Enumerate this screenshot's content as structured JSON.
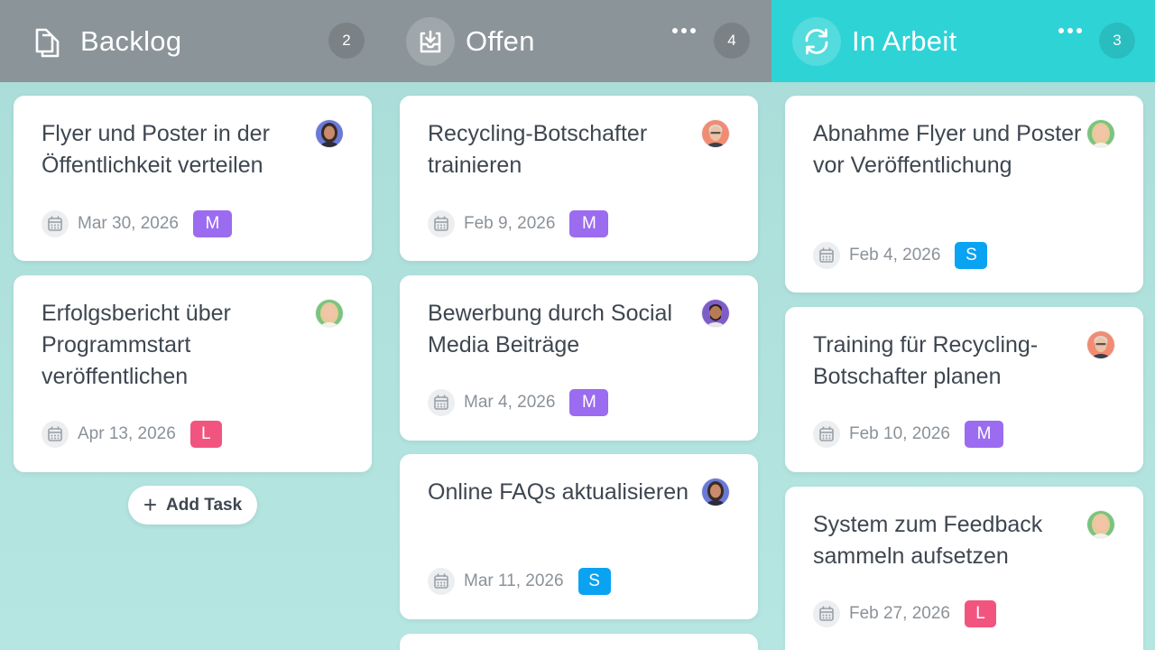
{
  "columns": [
    {
      "title": "Backlog",
      "count": "2",
      "cards": [
        {
          "title": "Flyer und Poster in der Öffentlichkeit verteilen",
          "date": "Mar 30, 2026",
          "size": "M",
          "avatar": "avatar-woman-dark-hair"
        },
        {
          "title": "Erfolgsbericht über Programmstart veröffentlichen",
          "date": "Apr 13, 2026",
          "size": "L",
          "avatar": "avatar-woman-blonde"
        }
      ],
      "add_task_label": "Add Task"
    },
    {
      "title": "Offen",
      "count": "4",
      "cards": [
        {
          "title": "Recycling-Botschafter trainieren",
          "date": "Feb 9, 2026",
          "size": "M",
          "avatar": "avatar-man-gray-hair"
        },
        {
          "title": "Bewerbung durch Social Media Beiträge",
          "date": "Mar 4, 2026",
          "size": "M",
          "avatar": "avatar-man-beard"
        },
        {
          "title": "Online FAQs aktualisieren",
          "date": "Mar 11, 2026",
          "size": "S",
          "avatar": "avatar-woman-dark-hair"
        }
      ]
    },
    {
      "title": "In Arbeit",
      "count": "3",
      "cards": [
        {
          "title": "Abnahme Flyer und Poster vor Veröffentlichung",
          "date": "Feb 4, 2026",
          "size": "S",
          "avatar": "avatar-woman-blonde"
        },
        {
          "title": "Training für Recycling-Botschafter planen",
          "date": "Feb 10, 2026",
          "size": "M",
          "avatar": "avatar-man-gray-hair"
        },
        {
          "title": "System zum Feedback sammeln aufsetzen",
          "date": "Feb 27, 2026",
          "size": "L",
          "avatar": "avatar-woman-blonde"
        }
      ]
    }
  ],
  "colors": {
    "header_gray": "#8b9499",
    "header_active": "#2ed3d6",
    "badge_M": "#9b6bf0",
    "badge_S": "#0aa3f2",
    "badge_L": "#f1557f",
    "board_bg": "#b0e0dc"
  },
  "icons": {
    "backlog": "copy-icon",
    "offen": "inbox-download-icon",
    "in_arbeit": "refresh-icon",
    "more": "more-dots-icon",
    "date": "calendar-icon",
    "add": "plus-icon"
  }
}
